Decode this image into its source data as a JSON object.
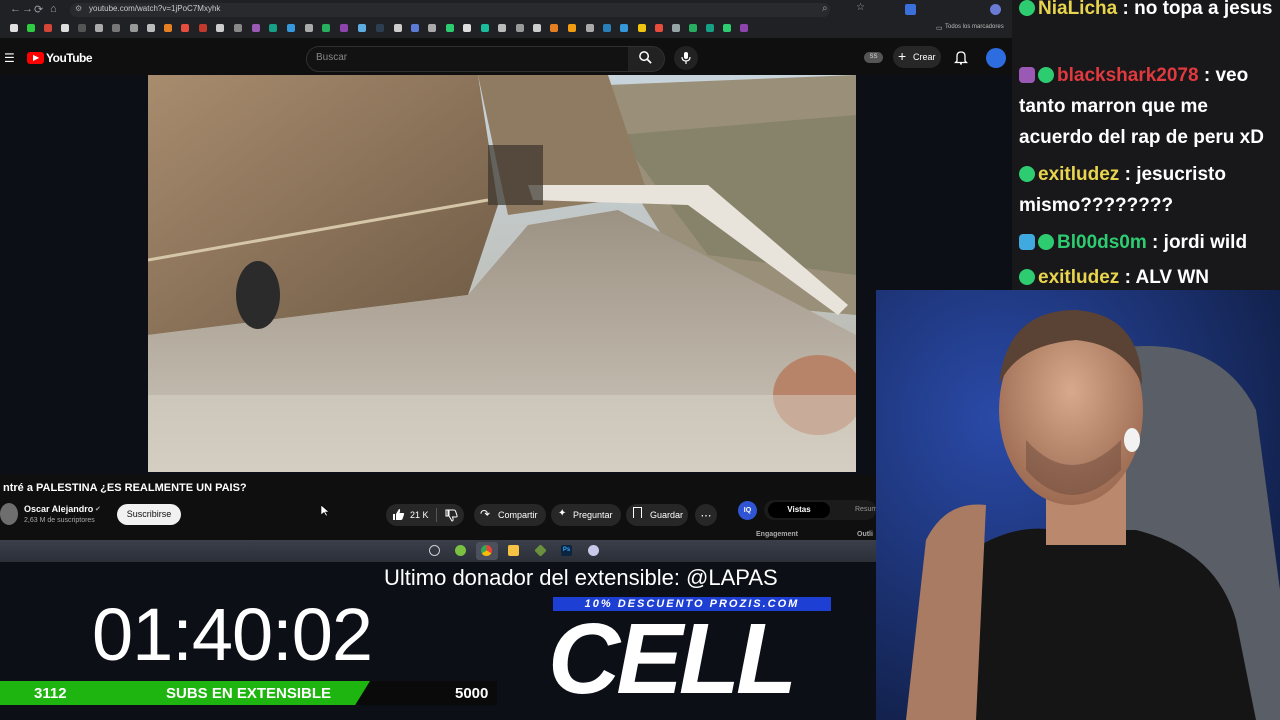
{
  "browser": {
    "url": "youtube.com/watch?v=1jPoC7Mxyhk",
    "bookmarks_folder": "Todos los marcadores"
  },
  "youtube": {
    "logo_text": "YouTube",
    "search_placeholder": "Buscar",
    "avatar_badge": "SS",
    "create_label": "Crear"
  },
  "video": {
    "title": "ntré a PALESTINA ¿ES REALMENTE UN PAIS?",
    "channel_name": "Oscar Alejandro",
    "subscribers": "2,63 M de suscriptores",
    "subscribe_label": "Suscribirse",
    "likes": "21 K",
    "share_label": "Compartir",
    "ask_label": "Preguntar",
    "save_label": "Guardar"
  },
  "extension_panel": {
    "tab_views": "Vistas",
    "tab_summary": "Resum",
    "engagement_label": "Engagement",
    "outlier_label": "Outli"
  },
  "stream_overlay": {
    "timer": "01:40:02",
    "last_donor": "Ultimo donador del extensible: @LAPAS",
    "promo": "10% DESCUENTO PROZIS.COM",
    "sponsor_logo": "CELL",
    "subs_current": "3112",
    "subs_label": "SUBS EN EXTENSIBLE",
    "subs_goal": "5000"
  },
  "chat": {
    "messages": [
      {
        "user": "NiaLicha",
        "text": "no topa a jesus",
        "color": "#e8d44d"
      },
      {
        "user": "blackshark2078",
        "text": "veo tanto marron que me acuerdo del rap de peru xD",
        "color": "#e0393e"
      },
      {
        "user": "exitludez",
        "text": "jesucristo mismo????????",
        "color": "#e8d44d"
      },
      {
        "user": "Bl00ds0m",
        "text": "jordi wild",
        "color": "#2ecc71"
      },
      {
        "user": "exitludez",
        "text": "ALV WN",
        "color": "#e8d44d"
      }
    ]
  }
}
